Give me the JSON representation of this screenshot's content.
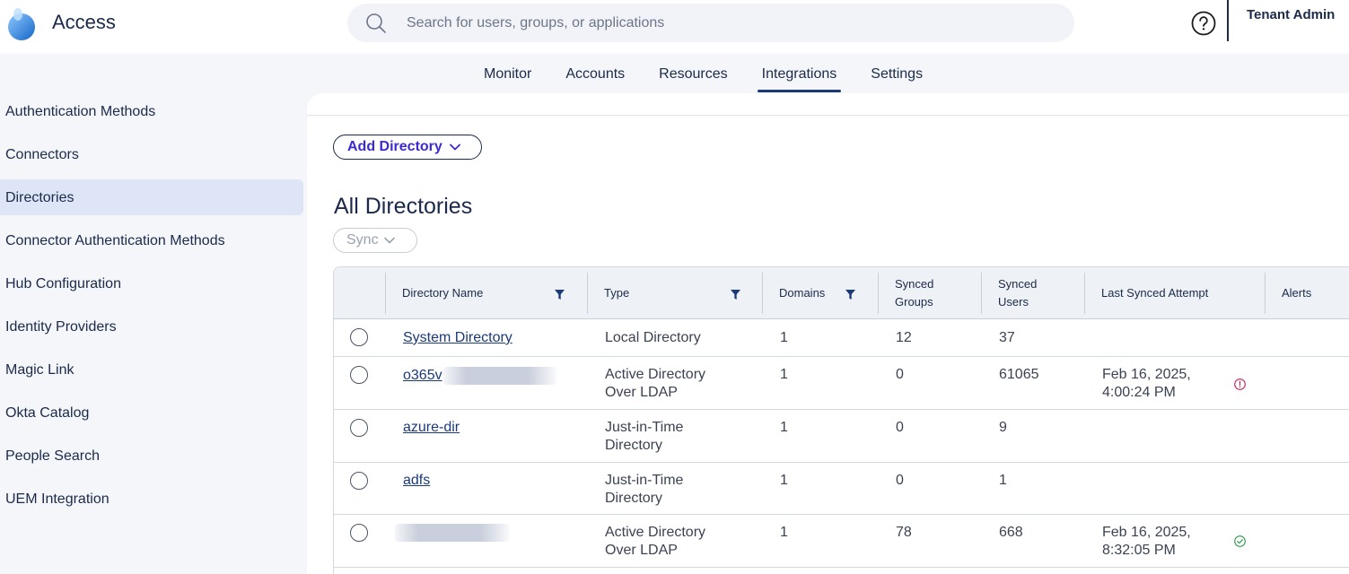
{
  "app": {
    "title": "Access"
  },
  "search": {
    "placeholder": "Search for users, groups, or applications"
  },
  "user": {
    "name": "Tenant Admin"
  },
  "nav": {
    "items": [
      {
        "label": "Monitor",
        "active": false
      },
      {
        "label": "Accounts",
        "active": false
      },
      {
        "label": "Resources",
        "active": false
      },
      {
        "label": "Integrations",
        "active": true
      },
      {
        "label": "Settings",
        "active": false
      }
    ]
  },
  "sidebar": {
    "items": [
      {
        "label": "Authentication Methods",
        "active": false
      },
      {
        "label": "Connectors",
        "active": false
      },
      {
        "label": "Directories",
        "active": true
      },
      {
        "label": "Connector Authentication Methods",
        "active": false
      },
      {
        "label": "Hub Configuration",
        "active": false
      },
      {
        "label": "Identity Providers",
        "active": false
      },
      {
        "label": "Magic Link",
        "active": false
      },
      {
        "label": "Okta Catalog",
        "active": false
      },
      {
        "label": "People Search",
        "active": false
      },
      {
        "label": "UEM Integration",
        "active": false
      }
    ]
  },
  "main": {
    "add_directory_label": "Add Directory",
    "title": "All Directories",
    "sync_label": "Sync"
  },
  "table": {
    "columns": [
      {
        "label": "Directory Name",
        "filter": true
      },
      {
        "label": "Type",
        "filter": true
      },
      {
        "label": "Domains",
        "filter": true
      },
      {
        "label": "Synced Groups",
        "line1": "Synced",
        "line2": "Groups",
        "filter": false
      },
      {
        "label": "Synced Users",
        "line1": "Synced",
        "line2": "Users",
        "filter": false
      },
      {
        "label": "Last Synced Attempt",
        "filter": false
      },
      {
        "label": "Alerts",
        "filter": false
      }
    ],
    "rows": [
      {
        "name": "System Directory",
        "type_line1": "Local Directory",
        "type_line2": "",
        "domains": "1",
        "groups": "12",
        "users": "37",
        "synced_line1": "",
        "synced_line2": "",
        "status": "none"
      },
      {
        "name": "o365v",
        "type_line1": "Active Directory",
        "type_line2": "Over LDAP",
        "domains": "1",
        "groups": "0",
        "users": "61065",
        "synced_line1": "Feb 16, 2025,",
        "synced_line2": "4:00:24 PM",
        "status": "error",
        "status_color": "#c0245c"
      },
      {
        "name": "azure-dir",
        "type_line1": "Just-in-Time",
        "type_line2": "Directory",
        "domains": "1",
        "groups": "0",
        "users": "9",
        "synced_line1": "",
        "synced_line2": "",
        "status": "none"
      },
      {
        "name": "adfs",
        "type_line1": "Just-in-Time",
        "type_line2": "Directory",
        "domains": "1",
        "groups": "0",
        "users": "1",
        "synced_line1": "",
        "synced_line2": "",
        "status": "none"
      },
      {
        "name": "",
        "type_line1": "Active Directory",
        "type_line2": "Over LDAP",
        "domains": "1",
        "groups": "78",
        "users": "668",
        "synced_line1": "Feb 16, 2025,",
        "synced_line2": "8:32:05 PM",
        "status": "success",
        "status_color": "#2e9a4a"
      }
    ]
  },
  "colors": {
    "accent": "#1b3a78",
    "link_button": "#3a2bd1",
    "logo": "#1f7ad6",
    "sidebar_active": "#dde5f7"
  }
}
